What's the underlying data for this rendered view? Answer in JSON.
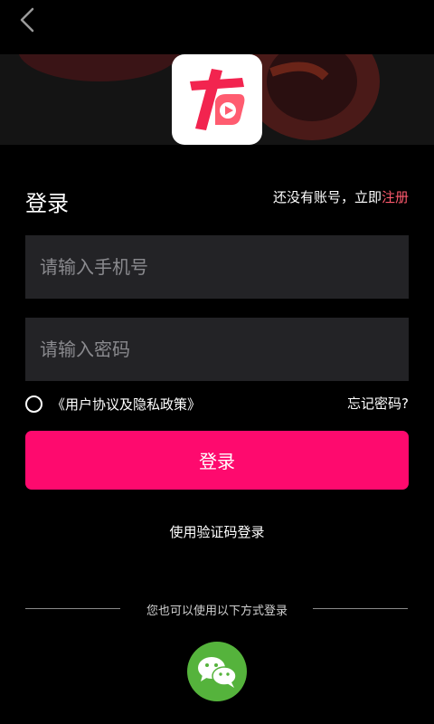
{
  "header": {
    "back_icon": "chevron-left-icon"
  },
  "logo": {
    "icon": "app-logo-icon",
    "colors": {
      "primary": "#f2244f",
      "secondary": "#ff5c70"
    }
  },
  "login": {
    "title": "登录",
    "register_hint": "还没有账号，立即",
    "register_link": "注册",
    "phone_placeholder": "请输入手机号",
    "phone_value": "",
    "password_placeholder": "请输入密码",
    "password_value": "",
    "agreement": "《用户协议及隐私政策》",
    "agreement_checked": false,
    "forgot": "忘记密码?",
    "submit": "登录",
    "sms_login": "使用验证码登录"
  },
  "alternatives": {
    "label": "您也可以使用以下方式登录",
    "wechat_icon": "wechat-icon"
  },
  "colors": {
    "accent": "#fe0a6e",
    "link": "#ff5a6e",
    "field_bg": "#232326",
    "wechat": "#55b33c"
  }
}
